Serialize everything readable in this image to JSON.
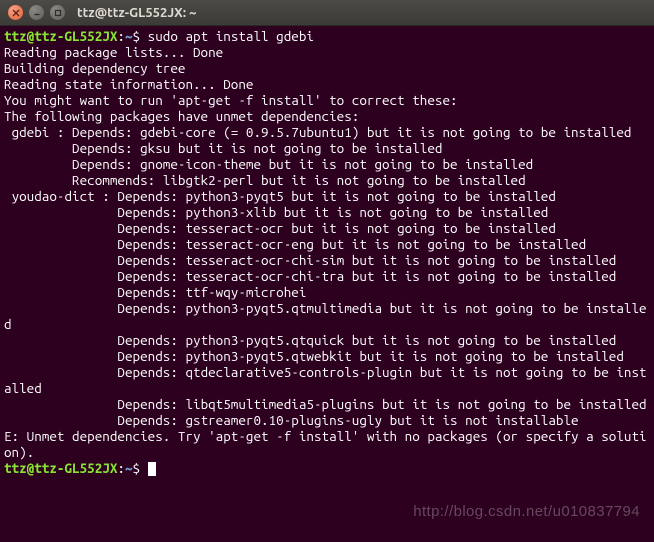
{
  "window": {
    "title": "ttz@ttz-GL552JX: ~"
  },
  "prompt": {
    "user_host": "ttz@ttz-GL552JX",
    "sep": ":",
    "path": "~",
    "dollar": "$ "
  },
  "cmd1": "sudo apt install gdebi",
  "lines": [
    "Reading package lists... Done",
    "Building dependency tree",
    "Reading state information... Done",
    "You might want to run 'apt-get -f install' to correct these:",
    "The following packages have unmet dependencies:",
    " gdebi : Depends: gdebi-core (= 0.9.5.7ubuntu1) but it is not going to be installed",
    "         Depends: gksu but it is not going to be installed",
    "         Depends: gnome-icon-theme but it is not going to be installed",
    "         Recommends: libgtk2-perl but it is not going to be installed",
    " youdao-dict : Depends: python3-pyqt5 but it is not going to be installed",
    "               Depends: python3-xlib but it is not going to be installed",
    "               Depends: tesseract-ocr but it is not going to be installed",
    "               Depends: tesseract-ocr-eng but it is not going to be installed",
    "               Depends: tesseract-ocr-chi-sim but it is not going to be installed",
    "               Depends: tesseract-ocr-chi-tra but it is not going to be installed",
    "               Depends: ttf-wqy-microhei",
    "               Depends: python3-pyqt5.qtmultimedia but it is not going to be installed",
    "               Depends: python3-pyqt5.qtquick but it is not going to be installed",
    "               Depends: python3-pyqt5.qtwebkit but it is not going to be installed",
    "               Depends: qtdeclarative5-controls-plugin but it is not going to be installed",
    "               Depends: libqt5multimedia5-plugins but it is not going to be installed",
    "               Depends: gstreamer0.10-plugins-ugly but it is not installable",
    "E: Unmet dependencies. Try 'apt-get -f install' with no packages (or specify a solution)."
  ],
  "watermark": "http://blog.csdn.net/u010837794"
}
